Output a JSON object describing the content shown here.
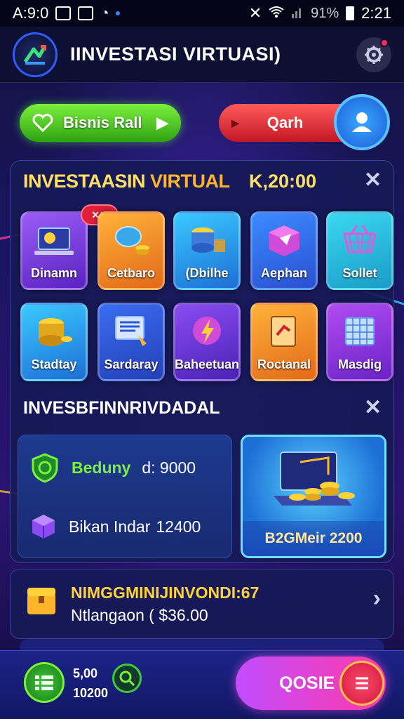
{
  "status_bar": {
    "left_text": "A:9:0",
    "battery": "91%",
    "time": "2:21"
  },
  "header": {
    "title": "IINVESTASI VIRTUASI)"
  },
  "actions": {
    "green_label": "Bisnis Rall",
    "red_label": "Qarh"
  },
  "panel": {
    "title_part1": "INVESTAASIN",
    "title_part2": "VIRTUAL",
    "amount": "K,20:00",
    "sub_title": "INVESBFINNRIVDADAL",
    "tiles": [
      {
        "label": "Dinamn",
        "icon": "laptop-icon",
        "color": "#7b3fe4"
      },
      {
        "label": "Cetbaro",
        "icon": "coins-icon",
        "color": "#f08a1c"
      },
      {
        "label": "(Dbilhe",
        "icon": "coin-stack-icon",
        "color": "#2aa0e8"
      },
      {
        "label": "Aephan",
        "icon": "cube-icon",
        "color": "#2f6fe8"
      },
      {
        "label": "Sollet",
        "icon": "basket-icon",
        "color": "#22b6d6"
      },
      {
        "label": "Stadtay",
        "icon": "gold-coins-icon",
        "color": "#1d8fe0"
      },
      {
        "label": "Sardaray",
        "icon": "monitor-icon",
        "color": "#2a57d6"
      },
      {
        "label": "Baheetuan",
        "icon": "lightning-icon",
        "color": "#6b2fd0"
      },
      {
        "label": "Roctanal",
        "icon": "document-icon",
        "color": "#f07a1c"
      },
      {
        "label": "Masdig",
        "icon": "calendar-icon",
        "color": "#8b2fd6"
      }
    ],
    "tile_badge": "✕✕",
    "card_left": {
      "row1_label": "Beduny",
      "row1_value": "d: 9000",
      "row2_label": "Bikan Indar",
      "row2_value": "12400"
    },
    "card_right": {
      "caption": "B2GMeir 2200"
    }
  },
  "promo": {
    "title": "NIMGGMINIJINVONDI:67",
    "subtitle": "Ntlangaon (",
    "value": "$36.00"
  },
  "bottom": {
    "stat1": "5,00",
    "stat2": "10200",
    "cta_label": "QOSIE"
  },
  "colors": {
    "accent_yellow": "#ffd23a",
    "accent_green": "#7cf03c",
    "accent_red": "#e0203a",
    "accent_magenta": "#c24cff"
  }
}
